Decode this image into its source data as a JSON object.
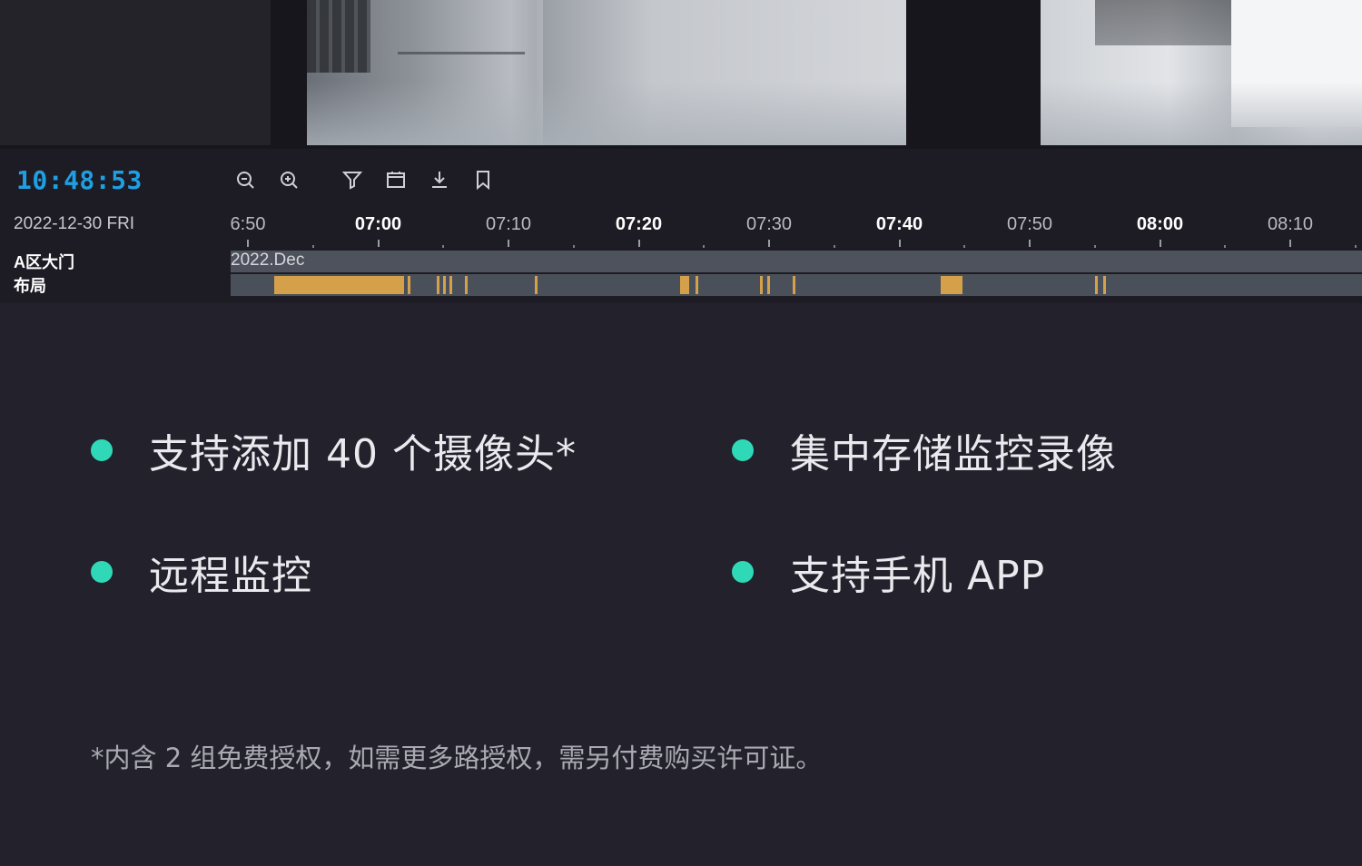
{
  "timeline": {
    "clock": "10:48:53",
    "date": "2022-12-30 FRI",
    "ticks": [
      {
        "label": "6:50",
        "major": false
      },
      {
        "label": "07:00",
        "major": true
      },
      {
        "label": "07:10",
        "major": false
      },
      {
        "label": "07:20",
        "major": true
      },
      {
        "label": "07:30",
        "major": false
      },
      {
        "label": "07:40",
        "major": true
      },
      {
        "label": "07:50",
        "major": false
      },
      {
        "label": "08:00",
        "major": true
      },
      {
        "label": "08:10",
        "major": false
      }
    ],
    "rows": [
      "A区大门",
      "布局"
    ],
    "month_label": "2022.Dec",
    "recordings": [
      [
        "06:52",
        "07:02"
      ],
      [
        "07:02:15",
        "07:02:30"
      ],
      [
        "07:04:30",
        "07:04:40"
      ],
      [
        "07:05:00",
        "07:05:10"
      ],
      [
        "07:05:30",
        "07:05:40"
      ],
      [
        "07:06:40",
        "07:06:50"
      ],
      [
        "07:12:00",
        "07:12:10"
      ],
      [
        "07:23:10",
        "07:23:50"
      ],
      [
        "07:24:20",
        "07:24:30"
      ],
      [
        "07:29:20",
        "07:29:30"
      ],
      [
        "07:29:50",
        "07:30:00"
      ],
      [
        "07:31:50",
        "07:32:00"
      ],
      [
        "07:43:10",
        "07:44:50"
      ],
      [
        "07:55:00",
        "07:55:10"
      ],
      [
        "07:55:40",
        "07:55:50"
      ]
    ],
    "tools": [
      "zoom-out-icon",
      "zoom-in-icon",
      "filter-icon",
      "calendar-icon",
      "download-icon",
      "bookmark-icon"
    ]
  },
  "features": [
    "支持添加 40 个摄像头*",
    "集中存储监控录像",
    "远程监控",
    "支持手机 APP"
  ],
  "footnote": "*内含 2 组免费授权，如需更多路授权，需另付费购买许可证。",
  "colors": {
    "clock": "#1f9fe3",
    "recording": "#d4a14a",
    "bullet": "#2fd9b8",
    "background": "#23222c"
  }
}
